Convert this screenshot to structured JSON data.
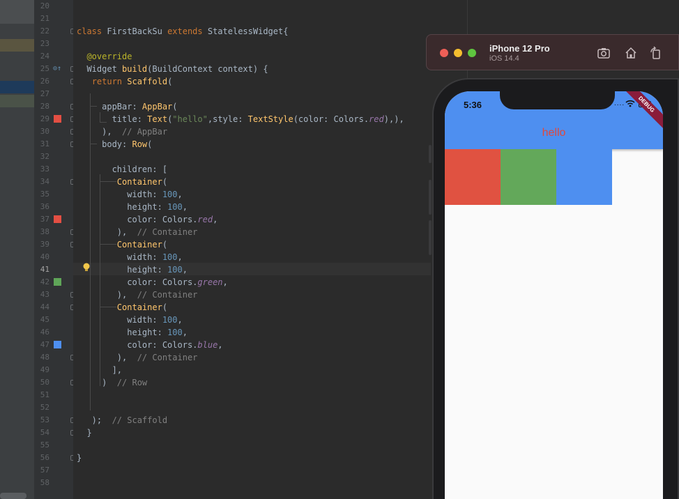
{
  "editor": {
    "lines": [
      {
        "num": "20",
        "html": ""
      },
      {
        "num": "21",
        "html": ""
      },
      {
        "num": "22",
        "html": "<span class='kw'>class </span>FirstBackSu <span class='kw'>extends </span>StatelessWidget{"
      },
      {
        "num": "23",
        "html": ""
      },
      {
        "num": "24",
        "html": "  <span class='an'>@override</span>"
      },
      {
        "num": "25",
        "html": "  Widget <span class='cls'>build</span>(BuildContext context) {"
      },
      {
        "num": "26",
        "html": "   <span class='kw'>return </span><span class='cls'>Scaffold</span>("
      },
      {
        "num": "27",
        "html": ""
      },
      {
        "num": "28",
        "html": "     appBar: <span class='cls'>AppBar</span>("
      },
      {
        "num": "29",
        "html": "       title: <span class='cls'>Text</span>(<span class='str'>\"hello\"</span>,style: <span class='cls'>TextStyle</span>(color: Colors.<span class='it'>red</span>),),"
      },
      {
        "num": "30",
        "html": "     ),  <span class='cm'>// AppBar</span>"
      },
      {
        "num": "31",
        "html": "     body: <span class='cls'>Row</span>("
      },
      {
        "num": "32",
        "html": ""
      },
      {
        "num": "33",
        "html": "       children: ["
      },
      {
        "num": "34",
        "html": "        <span class='cls'>Container</span>("
      },
      {
        "num": "35",
        "html": "          width: <span class='num'>100</span>,"
      },
      {
        "num": "36",
        "html": "          height: <span class='num'>100</span>,"
      },
      {
        "num": "37",
        "html": "          color: Colors.<span class='it'>red</span>,"
      },
      {
        "num": "38",
        "html": "        ),  <span class='cm'>// Container</span>"
      },
      {
        "num": "39",
        "html": "        <span class='cls'>Container</span>("
      },
      {
        "num": "40",
        "html": "          width: <span class='num'>100</span>,"
      },
      {
        "num": "41",
        "html": "          height: <span class='num'>100</span>,"
      },
      {
        "num": "42",
        "html": "          color: Colors.<span class='it'>green</span>,"
      },
      {
        "num": "43",
        "html": "        ),  <span class='cm'>// Container</span>"
      },
      {
        "num": "44",
        "html": "        <span class='cls'>Container</span>("
      },
      {
        "num": "45",
        "html": "          width: <span class='num'>100</span>,"
      },
      {
        "num": "46",
        "html": "          height: <span class='num'>100</span>,"
      },
      {
        "num": "47",
        "html": "          color: Colors.<span class='it'>blue</span>,"
      },
      {
        "num": "48",
        "html": "        ),  <span class='cm'>// Container</span>"
      },
      {
        "num": "49",
        "html": "       ],"
      },
      {
        "num": "50",
        "html": "     )  <span class='cm'>// Row</span>"
      },
      {
        "num": "51",
        "html": ""
      },
      {
        "num": "52",
        "html": ""
      },
      {
        "num": "53",
        "html": "   );  <span class='cm'>// Scaffold</span>"
      },
      {
        "num": "54",
        "html": "  }"
      },
      {
        "num": "55",
        "html": ""
      },
      {
        "num": "56",
        "html": "}"
      },
      {
        "num": "57",
        "html": ""
      },
      {
        "num": "58",
        "html": ""
      }
    ],
    "current_line": "41",
    "swatches": [
      {
        "line": "29",
        "color": "#e34f43"
      },
      {
        "line": "37",
        "color": "#e34f43"
      },
      {
        "line": "42",
        "color": "#5fa558"
      },
      {
        "line": "47",
        "color": "#4e8ff0"
      }
    ]
  },
  "simulator": {
    "device_name": "iPhone 12 Pro",
    "os_version": "iOS 14.4",
    "status_time": "5:36",
    "debug_banner": "DEBUG",
    "appbar_title": "hello",
    "appbar_color": "#4e8ff0",
    "title_color": "#e0483c",
    "boxes": [
      {
        "name": "red-container",
        "color": "#e05241"
      },
      {
        "name": "green-container",
        "color": "#63a85a"
      },
      {
        "name": "blue-container",
        "color": "#4e8ff0"
      }
    ],
    "toolbar_icons": [
      "screenshot-icon",
      "home-icon",
      "rotate-icon"
    ]
  }
}
